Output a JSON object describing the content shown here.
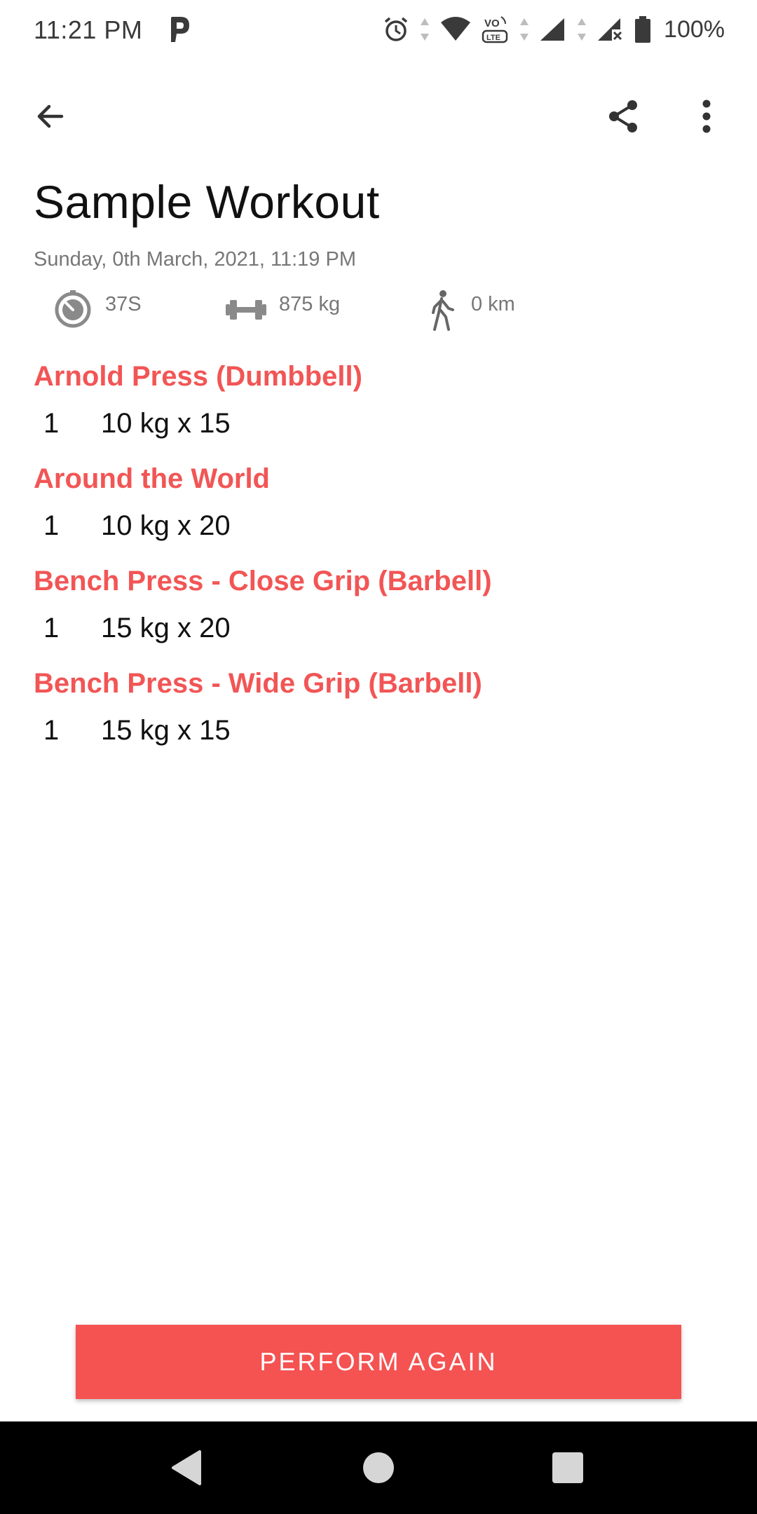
{
  "status_bar": {
    "time": "11:21 PM",
    "battery": "100%",
    "icons": [
      "parking-app-icon",
      "alarm-icon",
      "wifi-icon",
      "volte-icon",
      "signal-icon",
      "signal-no-sim-icon",
      "battery-icon"
    ]
  },
  "app_bar": {
    "back_icon": "arrow-back-icon",
    "share_icon": "share-icon",
    "more_icon": "more-vert-icon"
  },
  "workout": {
    "title": "Sample Workout",
    "datetime": "Sunday, 0th March, 2021, 11:19 PM",
    "stats": {
      "duration": "37S",
      "volume": "875 kg",
      "distance": "0 km"
    }
  },
  "exercises": [
    {
      "name": "Arnold Press (Dumbbell)",
      "sets": [
        {
          "index": "1",
          "detail": "10 kg x 15"
        }
      ]
    },
    {
      "name": "Around the World",
      "sets": [
        {
          "index": "1",
          "detail": "10 kg x 20"
        }
      ]
    },
    {
      "name": "Bench Press - Close Grip (Barbell)",
      "sets": [
        {
          "index": "1",
          "detail": "15 kg x 20"
        }
      ]
    },
    {
      "name": "Bench Press - Wide Grip (Barbell)",
      "sets": [
        {
          "index": "1",
          "detail": "15 kg x 15"
        }
      ]
    }
  ],
  "actions": {
    "perform_again": "PERFORM AGAIN"
  },
  "colors": {
    "accent": "#f55252",
    "exercise_title": "#f25555",
    "secondary_text": "#777777"
  }
}
